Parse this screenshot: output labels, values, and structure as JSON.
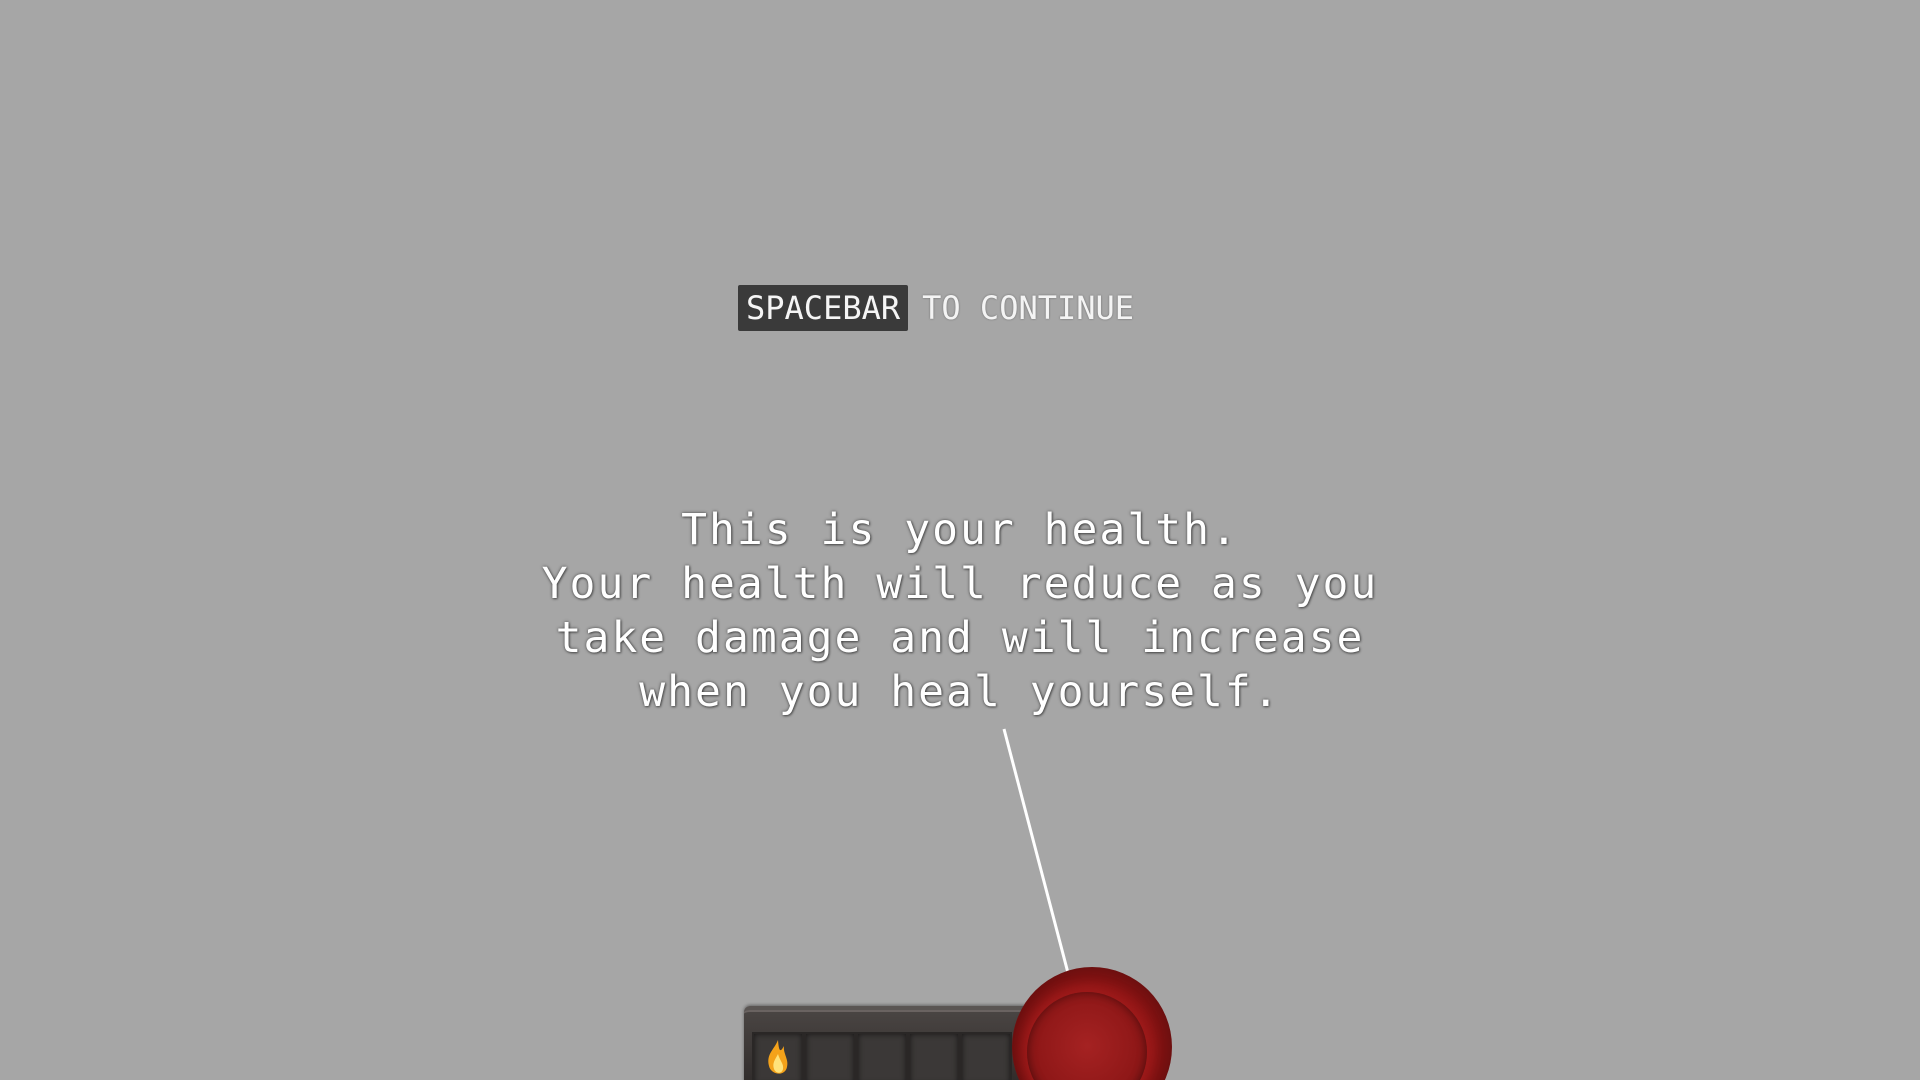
{
  "continue_prompt": {
    "key_label": "SPACEBAR",
    "action_text": "TO CONTINUE"
  },
  "tutorial": {
    "lines": [
      "This is your health.",
      "Your health will reduce as you",
      "take damage and will increase",
      "when you heal yourself."
    ]
  },
  "hotbar": {
    "slots": [
      {
        "item": "fire-icon"
      },
      {
        "item": ""
      },
      {
        "item": ""
      },
      {
        "item": ""
      },
      {
        "item": ""
      }
    ]
  },
  "colors": {
    "background": "#a6a6a6",
    "health": "#8e1717",
    "key_bg": "#3a3a3a"
  }
}
